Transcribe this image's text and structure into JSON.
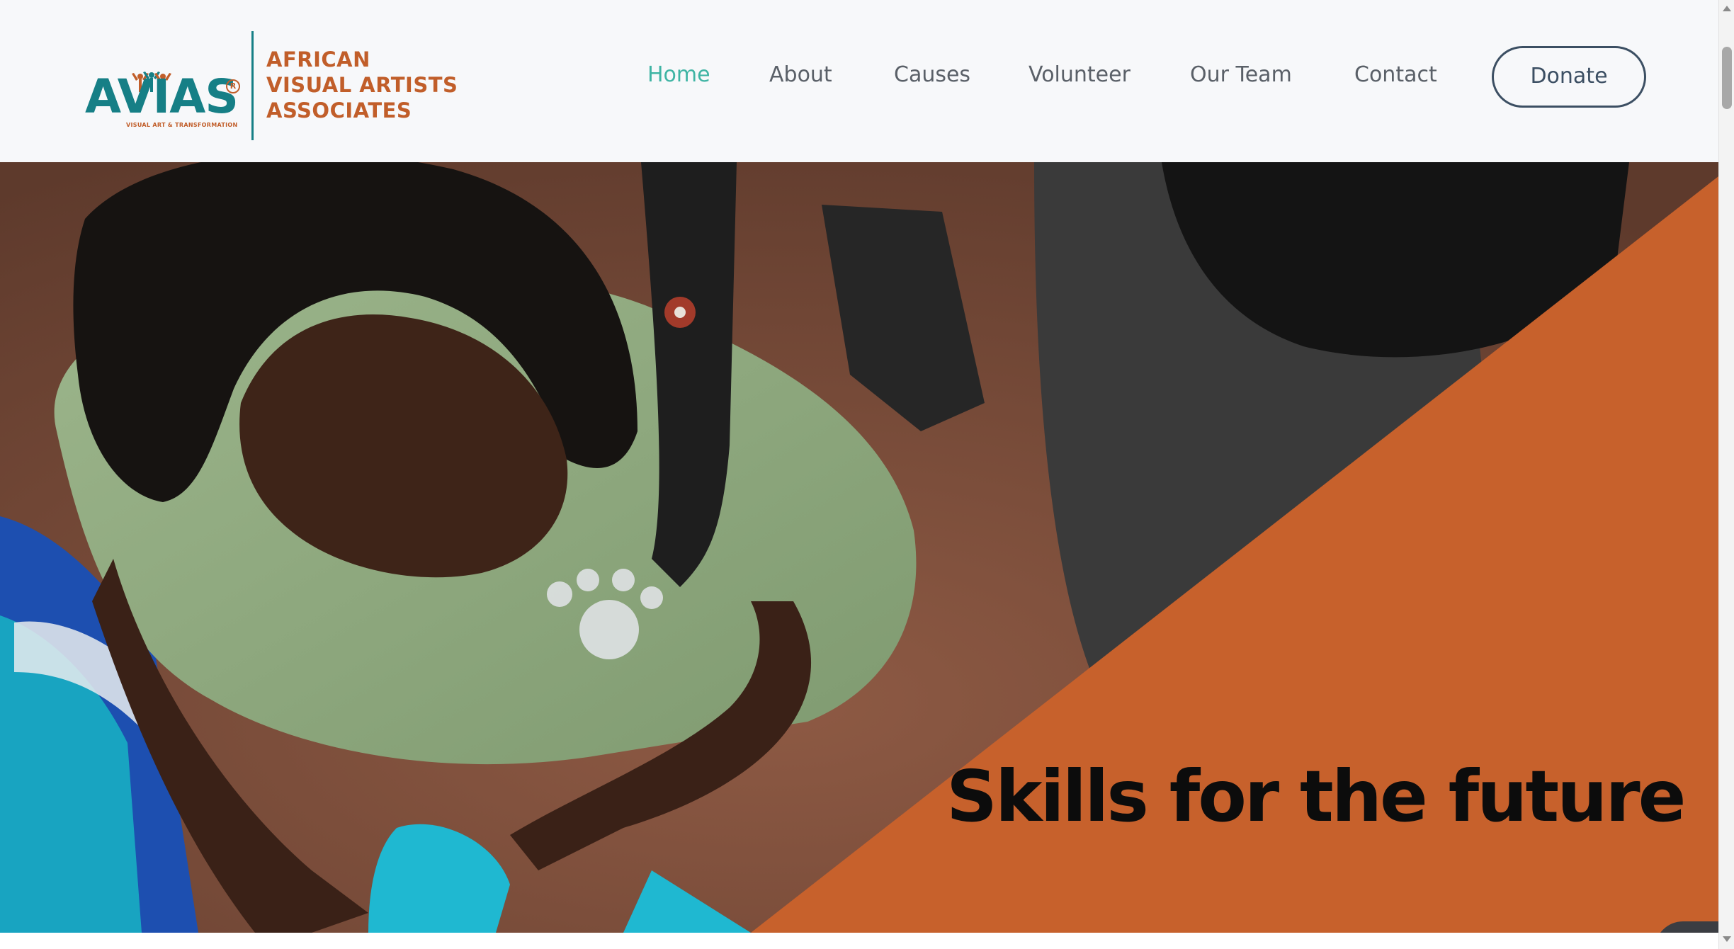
{
  "header": {
    "logo": {
      "short_name": "AVIAS",
      "tagline": "VISUAL ART & TRANSFORMATION",
      "registered_mark": "R",
      "name_line1": "AFRICAN",
      "name_line2": "VISUAL ARTISTS",
      "name_line3": "ASSOCIATES"
    },
    "nav": [
      {
        "label": "Home",
        "active": true
      },
      {
        "label": "About",
        "active": false
      },
      {
        "label": "Causes",
        "active": false
      },
      {
        "label": "Volunteer",
        "active": false
      },
      {
        "label": "Our Team",
        "active": false
      },
      {
        "label": "Contact",
        "active": false
      }
    ],
    "donate_label": "Donate"
  },
  "hero": {
    "heading": "Skills for the future",
    "image_description_icon": "photo-artists-working-icon"
  },
  "chat_widget": {
    "icon": "chat-assistant-icon"
  },
  "colors": {
    "brand_teal": "#167f86",
    "brand_orange": "#c15e2a",
    "nav_active": "#3fb4a4",
    "nav_text": "#5a6068",
    "donate_border": "#3c4f63",
    "hero_overlay": "#c7612c"
  }
}
